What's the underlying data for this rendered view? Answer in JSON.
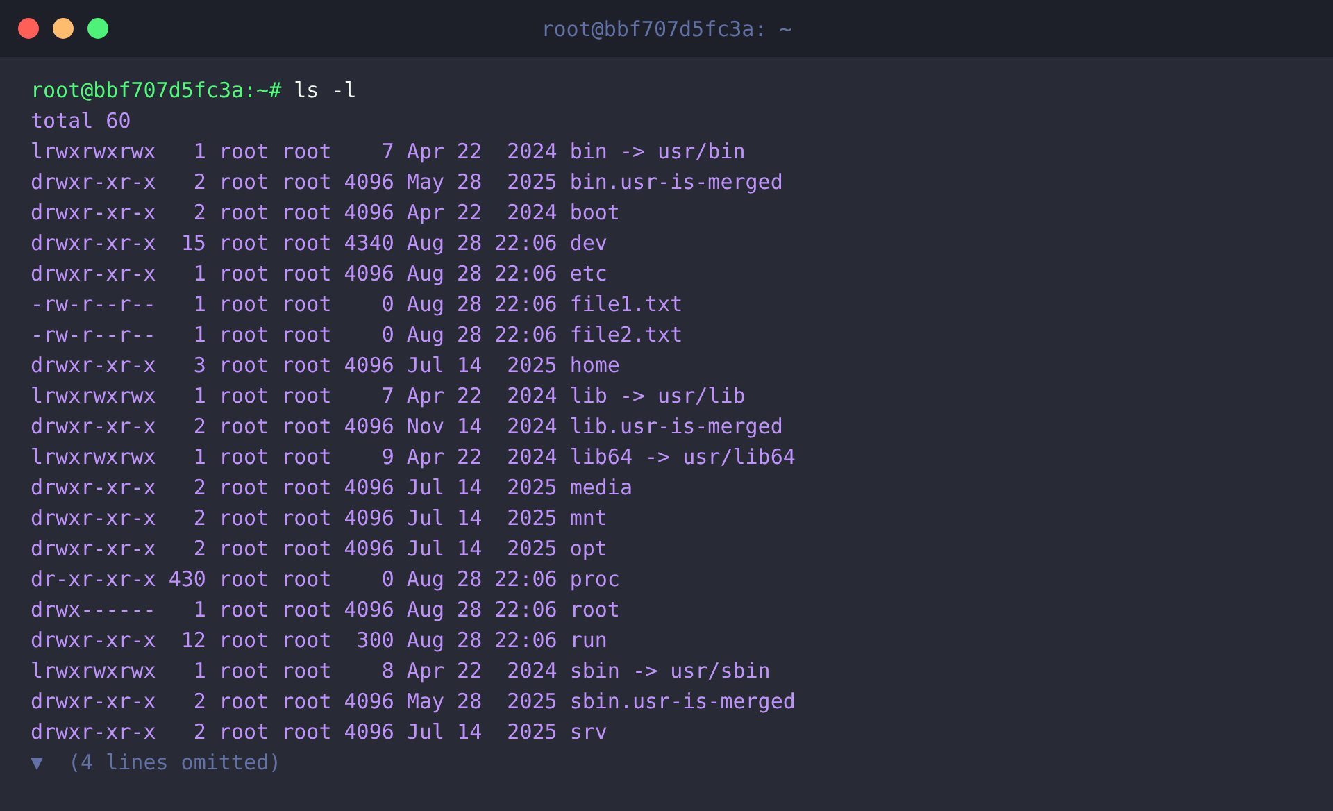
{
  "window": {
    "title": "root@bbf707d5fc3a: ~"
  },
  "prompt": {
    "text": "root@bbf707d5fc3a:~#",
    "command": "ls -l"
  },
  "output": [
    "total 60",
    "lrwxrwxrwx   1 root root    7 Apr 22  2024 bin -> usr/bin",
    "drwxr-xr-x   2 root root 4096 May 28  2025 bin.usr-is-merged",
    "drwxr-xr-x   2 root root 4096 Apr 22  2024 boot",
    "drwxr-xr-x  15 root root 4340 Aug 28 22:06 dev",
    "drwxr-xr-x   1 root root 4096 Aug 28 22:06 etc",
    "-rw-r--r--   1 root root    0 Aug 28 22:06 file1.txt",
    "-rw-r--r--   1 root root    0 Aug 28 22:06 file2.txt",
    "drwxr-xr-x   3 root root 4096 Jul 14  2025 home",
    "lrwxrwxrwx   1 root root    7 Apr 22  2024 lib -> usr/lib",
    "drwxr-xr-x   2 root root 4096 Nov 14  2024 lib.usr-is-merged",
    "lrwxrwxrwx   1 root root    9 Apr 22  2024 lib64 -> usr/lib64",
    "drwxr-xr-x   2 root root 4096 Jul 14  2025 media",
    "drwxr-xr-x   2 root root 4096 Jul 14  2025 mnt",
    "drwxr-xr-x   2 root root 4096 Jul 14  2025 opt",
    "dr-xr-xr-x 430 root root    0 Aug 28 22:06 proc",
    "drwx------   1 root root 4096 Aug 28 22:06 root",
    "drwxr-xr-x  12 root root  300 Aug 28 22:06 run",
    "lrwxrwxrwx   1 root root    8 Apr 22  2024 sbin -> usr/sbin",
    "drwxr-xr-x   2 root root 4096 May 28  2025 sbin.usr-is-merged",
    "drwxr-xr-x   2 root root 4096 Jul 14  2025 srv"
  ],
  "omitted": {
    "toggle": "▼",
    "label": "(4 lines omitted)",
    "expanded": false
  }
}
